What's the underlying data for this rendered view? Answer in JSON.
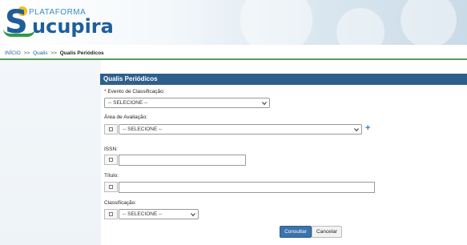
{
  "header": {
    "logo_small": "PLATAFORMA",
    "logo_name": "ucupira",
    "logo_initial": "S"
  },
  "breadcrumb": {
    "home": "INÍCIO",
    "sep": ">>",
    "qualis": "Qualis",
    "current": "Qualis Periódicos"
  },
  "panel": {
    "title": "Qualis Periódicos"
  },
  "form": {
    "required_mark": "*",
    "evento_label": "Evento de Classificação:",
    "evento_value": "-- SELECIONE --",
    "area_label": "Área de Avaliação:",
    "area_value": "-- SELECIONE --",
    "add_symbol": "+",
    "issn_label": "ISSN:",
    "issn_value": "",
    "titulo_label": "Título:",
    "titulo_value": "",
    "classificacao_label": "Classificação:",
    "classificacao_value": "-- SELECIONE --"
  },
  "actions": {
    "consultar": "Consultar",
    "cancelar": "Cancelar"
  },
  "colors": {
    "panel_header": "#2e5f8c",
    "primary_button": "#3a73ad",
    "accent_line": "#5a9b5e",
    "add_icon": "#2e7fc1"
  },
  "icons": [
    "dropdown-arrow-icon",
    "checkbox-icon",
    "plus-icon"
  ]
}
